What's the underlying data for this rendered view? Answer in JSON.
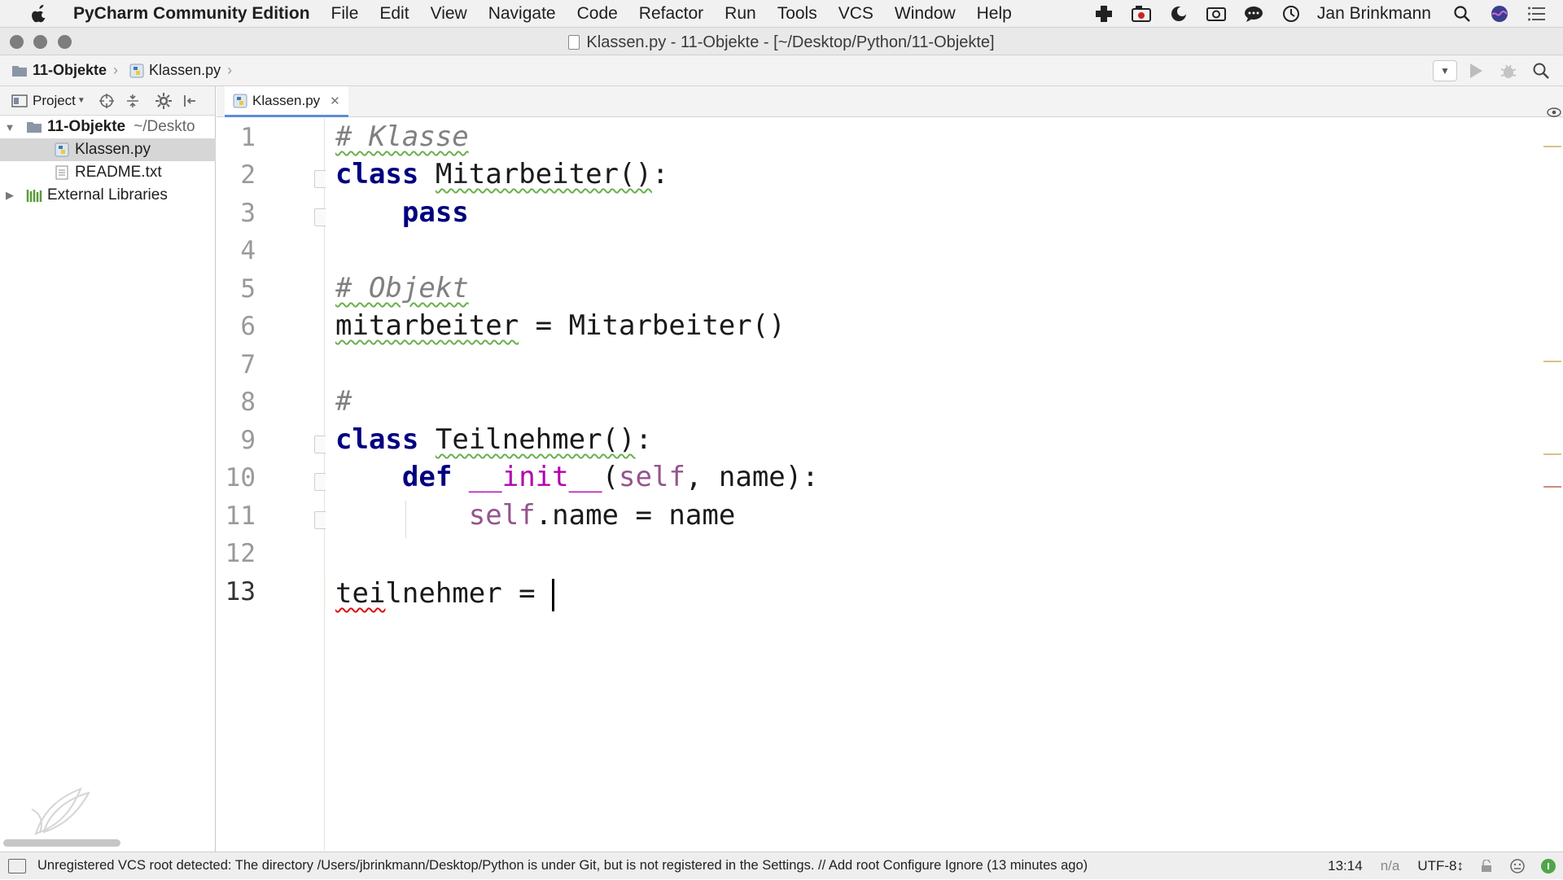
{
  "menubar": {
    "app_name": "PyCharm Community Edition",
    "menus": [
      "File",
      "Edit",
      "View",
      "Navigate",
      "Code",
      "Refactor",
      "Run",
      "Tools",
      "VCS",
      "Window",
      "Help"
    ],
    "user": "Jan Brinkmann"
  },
  "window": {
    "title": "Klassen.py - 11-Objekte - [~/Desktop/Python/11-Objekte]"
  },
  "navbar": {
    "breadcrumb": [
      "11-Objekte",
      "Klassen.py"
    ]
  },
  "project_panel": {
    "label": "Project",
    "tree": [
      {
        "name": "11-Objekte",
        "suffix": "~/Deskto",
        "type": "folder",
        "expanded": true
      },
      {
        "name": "Klassen.py",
        "type": "python-file",
        "selected": true
      },
      {
        "name": "README.txt",
        "type": "text-file"
      },
      {
        "name": "External Libraries",
        "type": "libraries",
        "expanded": false
      }
    ]
  },
  "editor": {
    "tab": "Klassen.py",
    "lines": [
      {
        "no": "1",
        "text": "# Klasse"
      },
      {
        "no": "2",
        "text": "class Mitarbeiter():"
      },
      {
        "no": "3",
        "text": "    pass"
      },
      {
        "no": "4",
        "text": ""
      },
      {
        "no": "5",
        "text": "# Objekt"
      },
      {
        "no": "6",
        "text": "mitarbeiter = Mitarbeiter()"
      },
      {
        "no": "7",
        "text": ""
      },
      {
        "no": "8",
        "text": "#"
      },
      {
        "no": "9",
        "text": "class Teilnehmer():"
      },
      {
        "no": "10",
        "text": "    def __init__(self, name):"
      },
      {
        "no": "11",
        "text": "        self.name = name"
      },
      {
        "no": "12",
        "text": ""
      },
      {
        "no": "13",
        "text": "teilnehmer = "
      }
    ],
    "current_line": "13"
  },
  "statusbar": {
    "message": "Unregistered VCS root detected: The directory /Users/jbrinkmann/Desktop/Python is under Git, but is not registered in the Settings. // Add root  Configure  Ignore (13 minutes ago)",
    "position": "13:14",
    "na": "n/a",
    "encoding": "UTF-8↕"
  },
  "colors": {
    "keyword": "#000080",
    "comment": "#808080",
    "self": "#94558d",
    "magic": "#b200b2",
    "current_line_bg": "#fffae3"
  }
}
